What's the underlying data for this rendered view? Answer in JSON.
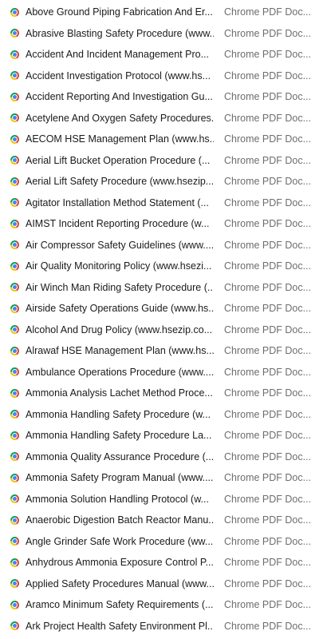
{
  "file_list": {
    "type_label": "Chrome PDF Doc...",
    "icon": "chrome-icon",
    "items": [
      {
        "name": "Above Ground Piping Fabrication And Er..."
      },
      {
        "name": "Abrasive Blasting Safety Procedure (www..."
      },
      {
        "name": "Accident And Incident Management Pro..."
      },
      {
        "name": "Accident Investigation Protocol (www.hs..."
      },
      {
        "name": "Accident Reporting And Investigation Gu..."
      },
      {
        "name": "Acetylene And Oxygen Safety Procedures..."
      },
      {
        "name": "AECOM HSE Management Plan (www.hs..."
      },
      {
        "name": "Aerial Lift Bucket Operation Procedure (..."
      },
      {
        "name": "Aerial Lift Safety Procedure (www.hsezip..."
      },
      {
        "name": "Agitator Installation Method Statement (..."
      },
      {
        "name": "AIMST Incident Reporting Procedure (w..."
      },
      {
        "name": "Air Compressor Safety Guidelines (www...."
      },
      {
        "name": "Air Quality Monitoring Policy (www.hsezi..."
      },
      {
        "name": "Air Winch Man Riding Safety Procedure (..."
      },
      {
        "name": "Airside Safety Operations Guide (www.hs..."
      },
      {
        "name": "Alcohol And Drug Policy (www.hsezip.co..."
      },
      {
        "name": "Alrawaf HSE Management Plan (www.hs..."
      },
      {
        "name": "Ambulance Operations Procedure (www...."
      },
      {
        "name": "Ammonia Analysis Lachet Method Proce..."
      },
      {
        "name": "Ammonia Handling Safety Procedure (w..."
      },
      {
        "name": "Ammonia Handling Safety Procedure La..."
      },
      {
        "name": "Ammonia Quality Assurance Procedure (..."
      },
      {
        "name": "Ammonia Safety Program Manual (www...."
      },
      {
        "name": "Ammonia Solution Handling Protocol (w..."
      },
      {
        "name": "Anaerobic Digestion Batch Reactor Manu..."
      },
      {
        "name": "Angle Grinder Safe Work Procedure (ww..."
      },
      {
        "name": "Anhydrous Ammonia Exposure Control P..."
      },
      {
        "name": "Applied Safety Procedures Manual (www...."
      },
      {
        "name": "Aramco Minimum Safety Requirements (..."
      },
      {
        "name": "Ark Project Health Safety Environment Pl..."
      }
    ]
  }
}
